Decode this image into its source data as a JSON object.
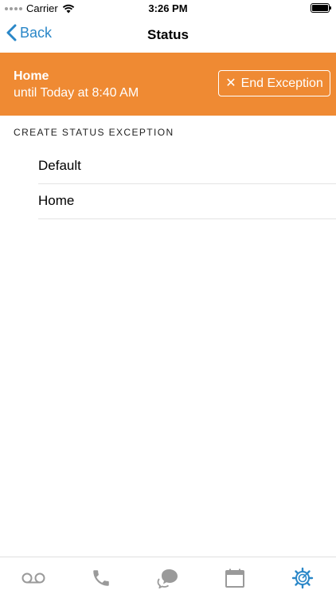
{
  "status_bar": {
    "carrier": "Carrier",
    "time": "3:26 PM"
  },
  "nav": {
    "back_label": "Back",
    "title": "Status"
  },
  "banner": {
    "title": "Home",
    "subtitle": "until Today at 8:40 AM",
    "end_button_label": "End Exception",
    "background": "#ef8a33"
  },
  "section": {
    "header": "CREATE STATUS EXCEPTION",
    "items": [
      {
        "label": "Default"
      },
      {
        "label": "Home"
      }
    ]
  },
  "tabs": [
    {
      "icon": "voicemail-icon",
      "active": false
    },
    {
      "icon": "phone-icon",
      "active": false
    },
    {
      "icon": "chat-icon",
      "active": false
    },
    {
      "icon": "calendar-icon",
      "active": false
    },
    {
      "icon": "settings-gear-icon",
      "active": true
    }
  ],
  "colors": {
    "accent": "#2a87c8",
    "tab_inactive": "#9a9a9a"
  }
}
